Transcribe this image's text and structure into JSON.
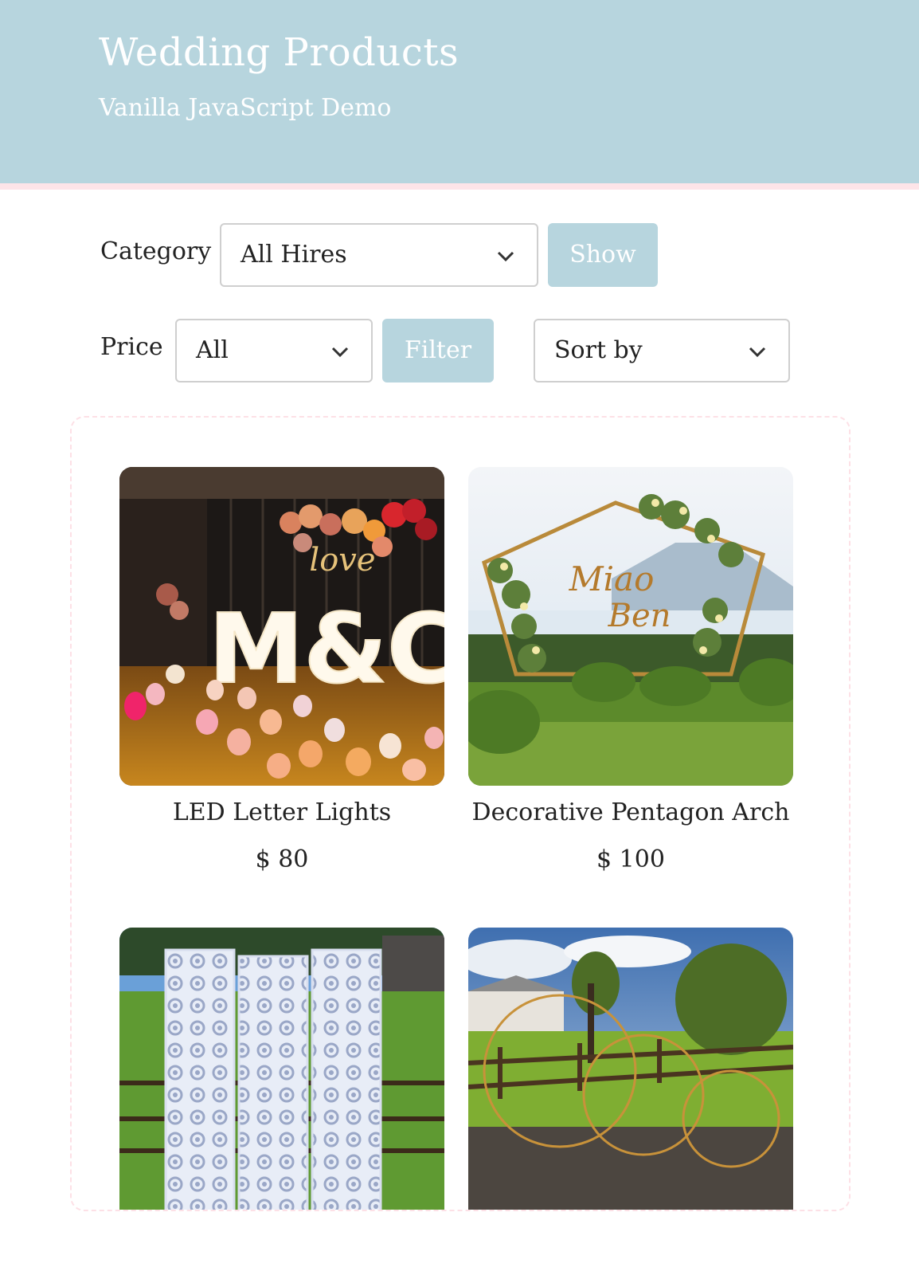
{
  "header": {
    "title": "Wedding Products",
    "subtitle": "Vanilla JavaScript Demo"
  },
  "filters": {
    "category_label": "Category",
    "category_selected": "All Hires",
    "show_label": "Show",
    "price_label": "Price",
    "price_selected": "All",
    "filter_label": "Filter",
    "sort_selected": "Sort by"
  },
  "products": [
    {
      "name": "LED Letter Lights",
      "price": "$ 80",
      "image_text": "M&C",
      "image_script": "love"
    },
    {
      "name": "Decorative Pentagon Arch",
      "price": "$ 100",
      "image_text_1": "Miao",
      "image_text_2": "Ben"
    },
    {
      "name": "",
      "price": ""
    },
    {
      "name": "",
      "price": ""
    }
  ],
  "colors": {
    "header_bg": "#b7d5de",
    "accent_border": "#fde4e8",
    "button_bg": "#b7d5de"
  }
}
